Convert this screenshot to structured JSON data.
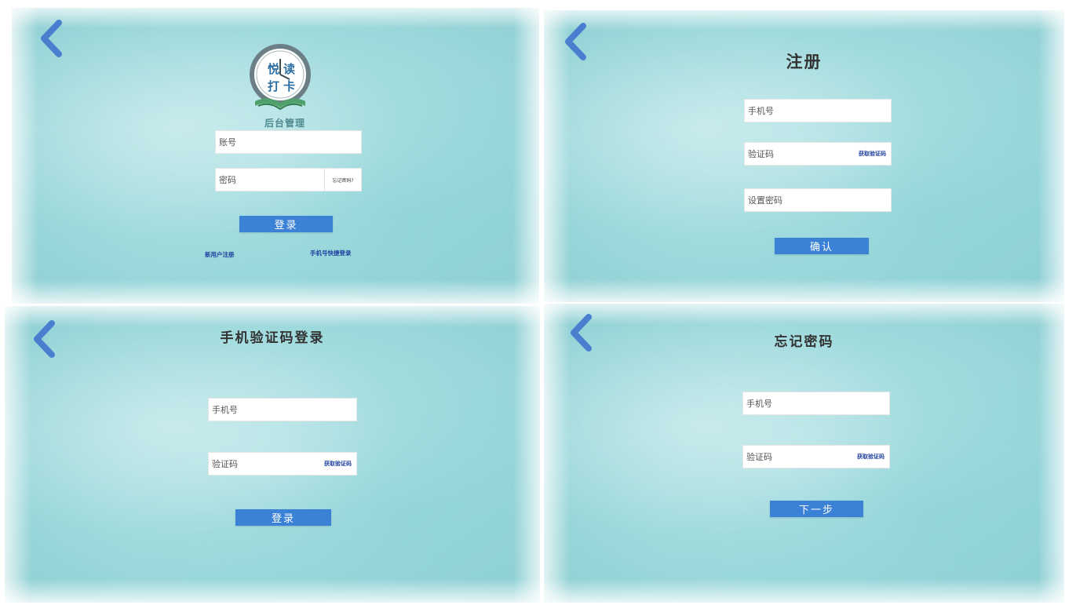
{
  "login": {
    "logo_chars": [
      "悦",
      "读",
      "打",
      "卡"
    ],
    "logo_subtitle": "后台管理",
    "account_placeholder": "账号",
    "password_placeholder": "密码",
    "forgot_label": "忘记密码?",
    "login_button": "登录",
    "register_link": "新用户注册",
    "phone_login_link": "手机号快捷登录"
  },
  "register": {
    "title": "注册",
    "phone_placeholder": "手机号",
    "code_placeholder": "验证码",
    "get_code": "获取验证码",
    "password_placeholder": "设置密码",
    "confirm_button": "确认"
  },
  "sms_login": {
    "title": "手机验证码登录",
    "phone_placeholder": "手机号",
    "code_placeholder": "验证码",
    "get_code": "获取验证码",
    "login_button": "登录"
  },
  "forgot": {
    "title": "忘记密码",
    "phone_placeholder": "手机号",
    "code_placeholder": "验证码",
    "get_code": "获取验证码",
    "next_button": "下一步"
  },
  "colors": {
    "accent": "#3b82d6",
    "back_arrow": "#4a7fd0",
    "link": "#1f3fa0"
  },
  "icons": [
    "back-arrow-icon",
    "logo-clock-book-icon"
  ]
}
